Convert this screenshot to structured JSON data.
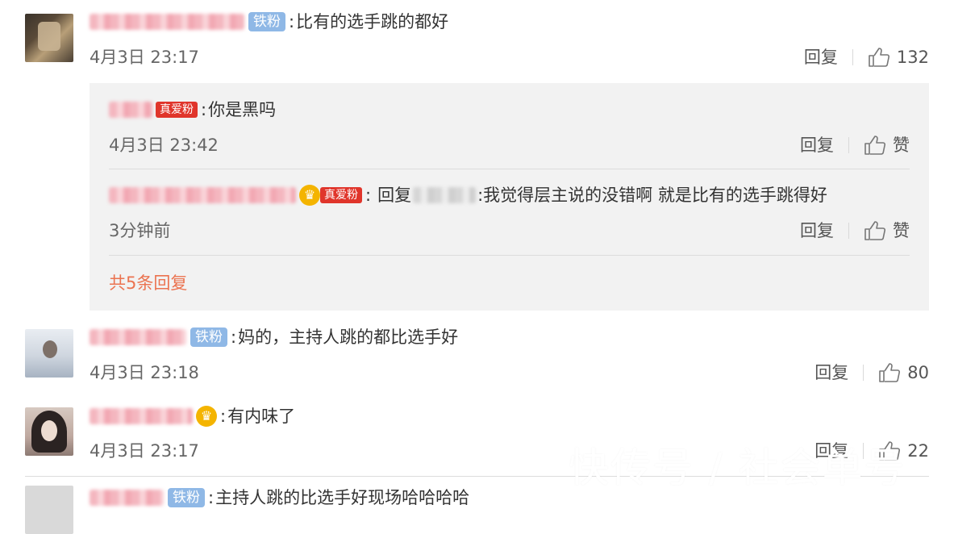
{
  "colors": {
    "accent_orange": "#eb7350",
    "badge_tie": "#8fb8e6",
    "badge_zhen": "#e0352b",
    "reply_bg": "#f2f2f2"
  },
  "comments": [
    {
      "badge": "铁粉",
      "text": "比有的选手跳的都好",
      "time": "4月3日 23:17",
      "reply_label": "回复",
      "like_count": "132"
    },
    {
      "badge": "铁粉",
      "text": "妈的，主持人跳的都比选手好",
      "time": "4月3日 23:18",
      "reply_label": "回复",
      "like_count": "80"
    },
    {
      "badge_icon": "crown-icon",
      "text": "有内味了",
      "time": "4月3日 23:17",
      "reply_label": "回复",
      "like_count": "22"
    }
  ],
  "replies": [
    {
      "badge": "真爱粉",
      "text": "你是黑吗",
      "time": "4月3日 23:42",
      "reply_label": "回复",
      "like_label": "赞"
    },
    {
      "badge": "真爱粉",
      "reply_prefix": "回复",
      "text": ":我觉得层主说的没错啊  就是比有的选手跳得好",
      "time": "3分钟前",
      "reply_label": "回复",
      "like_label": "赞"
    }
  ],
  "more_replies": "共5条回复",
  "partial_comment": {
    "badge": "铁粉",
    "text": "主持人跳的比选手好现场哈哈哈哈"
  },
  "watermark": "快传号 / 社会单号"
}
